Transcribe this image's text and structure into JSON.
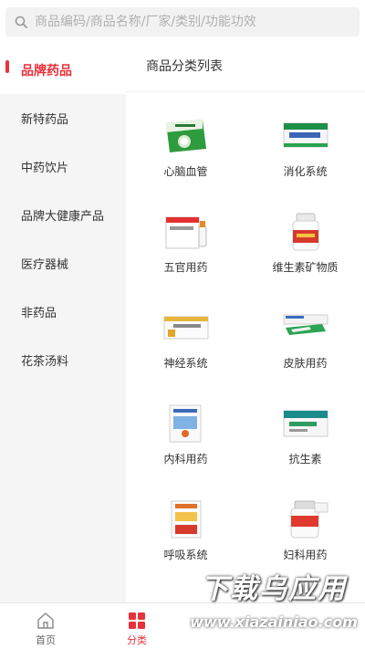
{
  "search": {
    "placeholder": "商品编码/商品名称/厂家/类别/功能功效"
  },
  "sidebar": {
    "items": [
      {
        "label": "品牌药品",
        "active": true
      },
      {
        "label": "新特药品",
        "active": false
      },
      {
        "label": "中药饮片",
        "active": false
      },
      {
        "label": "品牌大健康产品",
        "active": false
      },
      {
        "label": "医疗器械",
        "active": false
      },
      {
        "label": "非药品",
        "active": false
      },
      {
        "label": "花茶汤料",
        "active": false
      }
    ]
  },
  "main": {
    "title": "商品分类列表",
    "categories": [
      {
        "label": "心脑血管",
        "icon": "medicine-box-green-icon"
      },
      {
        "label": "消化系统",
        "icon": "medicine-box-jianwei-icon"
      },
      {
        "label": "五官用药",
        "icon": "eye-drops-icon"
      },
      {
        "label": "维生素矿物质",
        "icon": "vitamin-bottle-icon"
      },
      {
        "label": "神经系统",
        "icon": "medicine-box-yellow-icon"
      },
      {
        "label": "皮肤用药",
        "icon": "ointment-tube-icon"
      },
      {
        "label": "内科用药",
        "icon": "medicine-box-blue-icon"
      },
      {
        "label": "抗生素",
        "icon": "antibiotic-box-icon"
      },
      {
        "label": "呼吸系统",
        "icon": "medicine-box-orange-icon"
      },
      {
        "label": "妇科用药",
        "icon": "capsule-bottle-icon"
      }
    ]
  },
  "tabbar": {
    "tabs": [
      {
        "label": "首页",
        "icon": "home-icon",
        "active": false
      },
      {
        "label": "分类",
        "icon": "grid-icon",
        "active": true
      }
    ]
  },
  "watermark": {
    "title": "下载乌应用",
    "url": "www.xiazainiao.com"
  },
  "colors": {
    "accent": "#e8313a",
    "sidebar_bg": "#f5f5f5",
    "text": "#333333"
  }
}
